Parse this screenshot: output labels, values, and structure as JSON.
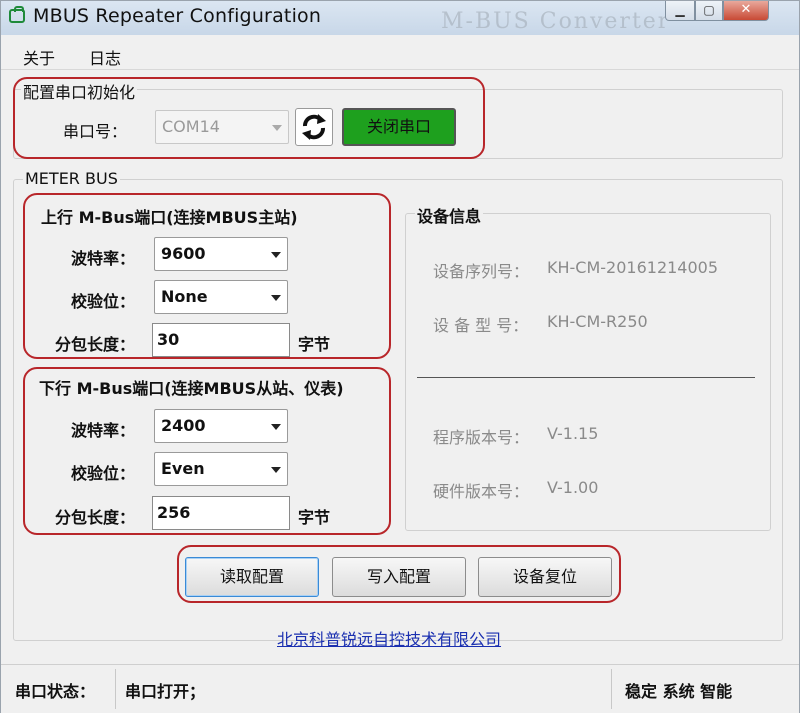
{
  "window": {
    "title": "MBUS Repeater Configuration",
    "watermark": "M-BUS Converter"
  },
  "menu": [
    "关于",
    "日志"
  ],
  "serial": {
    "group_label": "配置串口初始化",
    "port_label": "串口号：",
    "port_value": "COM14",
    "refresh_icon": "refresh-icon",
    "close_button": "关闭串口"
  },
  "meterbus": {
    "group_label": "METER BUS",
    "upstream": {
      "title": "上行 M-Bus端口(连接MBUS主站)",
      "baud_label": "波特率：",
      "baud_value": "9600",
      "parity_label": "校验位：",
      "parity_value": "None",
      "packet_label": "分包长度：",
      "packet_value": "30",
      "packet_unit": "字节"
    },
    "downstream": {
      "title": "下行 M-Bus端口(连接MBUS从站、仪表)",
      "baud_label": "波特率：",
      "baud_value": "2400",
      "parity_label": "校验位：",
      "parity_value": "Even",
      "packet_label": "分包长度：",
      "packet_value": "256",
      "packet_unit": "字节"
    },
    "device_info": {
      "title": "设备信息",
      "serial_label": "设备序列号：",
      "serial_value": "KH-CM-20161214005",
      "model_label": "设 备 型 号：",
      "model_value": "KH-CM-R250",
      "fw_label": "程序版本号：",
      "fw_value": "V-1.15",
      "hw_label": "硬件版本号：",
      "hw_value": "V-1.00"
    }
  },
  "actions": {
    "read": "读取配置",
    "write": "写入配置",
    "reset": "设备复位"
  },
  "company_link": "北京科普锐远自控技术有限公司",
  "status": {
    "label": "串口状态：",
    "value": "串口打开；",
    "slogan": "稳定 系统 智能"
  },
  "colors": {
    "close_button": "#1ea01e",
    "highlight_border": "#b8262a",
    "link": "#1a2fb0"
  }
}
